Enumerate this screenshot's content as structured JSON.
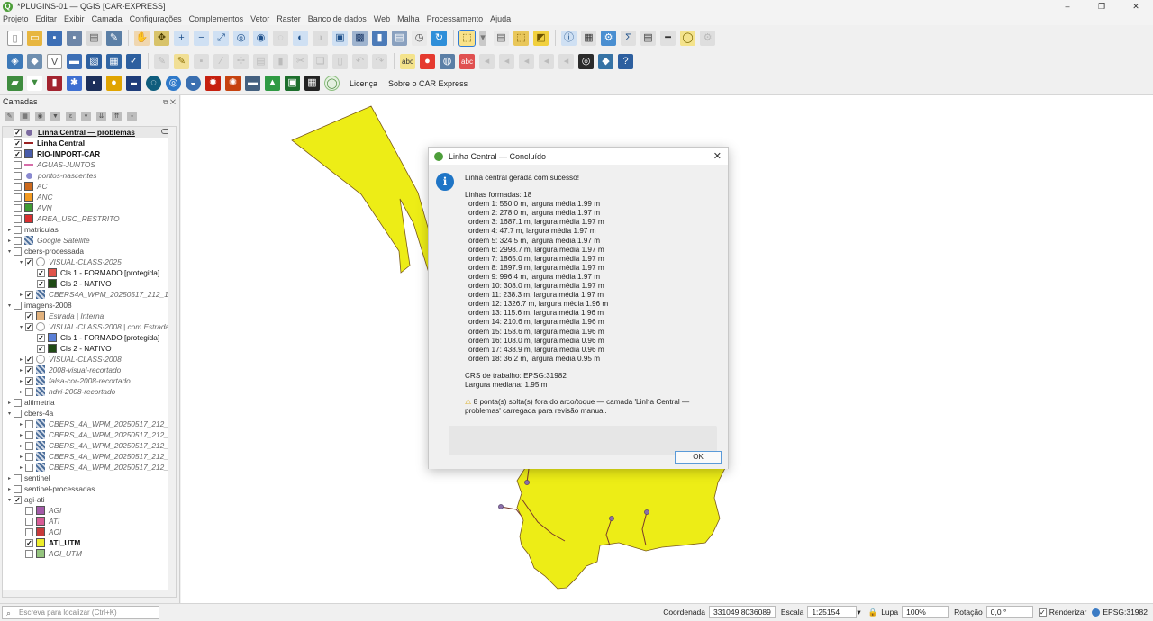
{
  "window": {
    "title": "*PLUGINS-01 — QGIS [CAR-EXPRESS]",
    "controls": [
      "–",
      "❐",
      "✕"
    ]
  },
  "menu": [
    "Projeto",
    "Editar",
    "Exibir",
    "Camada",
    "Configurações",
    "Complementos",
    "Vetor",
    "Raster",
    "Banco de dados",
    "Web",
    "Malha",
    "Processamento",
    "Ajuda"
  ],
  "toolbar3": {
    "licenca": "Licença",
    "sobre": "Sobre o CAR Express"
  },
  "layers_panel": {
    "title": "Camadas",
    "items": [
      {
        "label": "Linha Central — problemas",
        "style": "bu",
        "checked": true,
        "indent": 0,
        "swatch": "#7b6aa0",
        "shape": "dot"
      },
      {
        "label": "Linha Central",
        "style": "b",
        "checked": true,
        "indent": 0,
        "swatch": "#9b2222",
        "shape": "line"
      },
      {
        "label": "RIO-IMPORT-CAR",
        "style": "b",
        "checked": true,
        "indent": 0,
        "swatch": "#4a5dab"
      },
      {
        "label": "AGUAS-JUNTOS",
        "style": "it",
        "checked": false,
        "indent": 0,
        "swatch": "#d66da8",
        "shape": "line"
      },
      {
        "label": "pontos-nascentes",
        "style": "it",
        "checked": false,
        "indent": 0,
        "swatch": "#8a8ad0",
        "shape": "dot"
      },
      {
        "label": "AC",
        "style": "it",
        "checked": false,
        "indent": 0,
        "swatch": "#cc6a1e"
      },
      {
        "label": "ANC",
        "style": "it",
        "checked": false,
        "indent": 0,
        "swatch": "#f29a21"
      },
      {
        "label": "AVN",
        "style": "it",
        "checked": false,
        "indent": 0,
        "swatch": "#3f9c35"
      },
      {
        "label": "AREA_USO_RESTRITO",
        "style": "it",
        "checked": false,
        "indent": 0,
        "swatch": "#d93030"
      },
      {
        "label": "matriculas",
        "style": "gr",
        "checked": false,
        "indent": 0,
        "group": true
      },
      {
        "label": "Google Satellite",
        "style": "it",
        "checked": false,
        "indent": 0,
        "raster": true,
        "exp": true
      },
      {
        "label": "cbers-processada",
        "style": "gr",
        "checked": false,
        "indent": 0,
        "group": true,
        "open": true
      },
      {
        "label": "VISUAL-CLASS-2025",
        "style": "it",
        "checked": true,
        "indent": 1,
        "open": true,
        "vector": true
      },
      {
        "label": "Cls 1 - FORMADO [protegida]",
        "style": "",
        "checked": true,
        "indent": 2,
        "swatch": "#e0534a"
      },
      {
        "label": "Cls 2 - NATIVO",
        "style": "",
        "checked": true,
        "indent": 2,
        "swatch": "#1f4a15"
      },
      {
        "label": "CBERS4A_WPM_20250517_212_135_L",
        "style": "it",
        "checked": true,
        "indent": 1,
        "raster": true,
        "exp": true
      },
      {
        "label": "imagens-2008",
        "style": "gr",
        "checked": false,
        "indent": 0,
        "group": true,
        "open": true
      },
      {
        "label": "Estrada | Interna",
        "style": "it",
        "checked": true,
        "indent": 1,
        "swatch": "#e2b27d"
      },
      {
        "label": "VISUAL-CLASS-2008 | com Estradas",
        "style": "it",
        "checked": true,
        "indent": 1,
        "open": true,
        "vector": true
      },
      {
        "label": "Cls 1 - FORMADO [protegida]",
        "style": "",
        "checked": true,
        "indent": 2,
        "swatch": "#5a7fd6"
      },
      {
        "label": "Cls 2 - NATIVO",
        "style": "",
        "checked": true,
        "indent": 2,
        "swatch": "#1f4a15"
      },
      {
        "label": "VISUAL-CLASS-2008",
        "style": "it",
        "checked": true,
        "indent": 1,
        "vector": true,
        "exp": true
      },
      {
        "label": "2008-visual-recortado",
        "style": "it",
        "checked": true,
        "indent": 1,
        "raster": true,
        "exp": true
      },
      {
        "label": "falsa-cor-2008-recortado",
        "style": "it",
        "checked": true,
        "indent": 1,
        "raster": true,
        "exp": true
      },
      {
        "label": "ndvi-2008-recortado",
        "style": "it",
        "checked": false,
        "indent": 1,
        "raster": true,
        "exp": true
      },
      {
        "label": "altimetria",
        "style": "gr",
        "checked": false,
        "indent": 0,
        "group": true
      },
      {
        "label": "cbers-4a",
        "style": "gr",
        "checked": false,
        "indent": 0,
        "group": true,
        "open": true
      },
      {
        "label": "CBERS_4A_WPM_20250517_212_135_",
        "style": "it",
        "checked": false,
        "indent": 1,
        "raster": true,
        "exp": true
      },
      {
        "label": "CBERS_4A_WPM_20250517_212_135_",
        "style": "it",
        "checked": false,
        "indent": 1,
        "raster": true,
        "exp": true
      },
      {
        "label": "CBERS_4A_WPM_20250517_212_135_",
        "style": "it",
        "checked": false,
        "indent": 1,
        "raster": true,
        "exp": true
      },
      {
        "label": "CBERS_4A_WPM_20250517_212_135_",
        "style": "it",
        "checked": false,
        "indent": 1,
        "raster": true,
        "exp": true
      },
      {
        "label": "CBERS_4A_WPM_20250517_212_135_",
        "style": "it",
        "checked": false,
        "indent": 1,
        "raster": true,
        "exp": true
      },
      {
        "label": "sentinel",
        "style": "gr",
        "checked": false,
        "indent": 0,
        "group": true
      },
      {
        "label": "sentinel-processadas",
        "style": "gr",
        "checked": false,
        "indent": 0,
        "group": true
      },
      {
        "label": "agi-ati",
        "style": "gr",
        "checked": true,
        "indent": 0,
        "group": true,
        "open": true
      },
      {
        "label": "AGI",
        "style": "it",
        "checked": false,
        "indent": 1,
        "swatch": "#a35aa8"
      },
      {
        "label": "ATI",
        "style": "it",
        "checked": false,
        "indent": 1,
        "swatch": "#d85c96"
      },
      {
        "label": "AOI",
        "style": "it",
        "checked": false,
        "indent": 1,
        "swatch": "#c83a3a"
      },
      {
        "label": "ATI_UTM",
        "style": "b",
        "checked": true,
        "indent": 1,
        "swatch": "#eded2a"
      },
      {
        "label": "AOI_UTM",
        "style": "it",
        "checked": false,
        "indent": 1,
        "swatch": "#94c47e"
      }
    ]
  },
  "dialog": {
    "title": "Linha Central — Concluído",
    "success": "Linha central gerada com sucesso!",
    "lines_title": "Linhas formadas: 18",
    "lines": [
      "ordem 1: 550.0 m, largura média 1.99 m",
      "ordem 2: 278.0 m, largura média 1.97 m",
      "ordem 3: 1687.1 m, largura média 1.97 m",
      "ordem 4: 47.7 m, largura média 1.97 m",
      "ordem 5: 324.5 m, largura média 1.97 m",
      "ordem 6: 2998.7 m, largura média 1.97 m",
      "ordem 7: 1865.0 m, largura média 1.97 m",
      "ordem 8: 1897.9 m, largura média 1.97 m",
      "ordem 9: 996.4 m, largura média 1.97 m",
      "ordem 10: 308.0 m, largura média 1.97 m",
      "ordem 11: 238.3 m, largura média 1.97 m",
      "ordem 12: 1326.7 m, largura média 1.96 m",
      "ordem 13: 115.6 m, largura média 1.96 m",
      "ordem 14: 210.6 m, largura média 1.96 m",
      "ordem 15: 158.6 m, largura média 1.96 m",
      "ordem 16: 108.0 m, largura média 0.96 m",
      "ordem 17: 438.9 m, largura média 0.96 m",
      "ordem 18: 36.2 m, largura média 0.95 m"
    ],
    "crs": "CRS de trabalho: EPSG:31982",
    "median": "Largura mediana: 1.95 m",
    "warning": "8 ponta(s) solta(s) fora do arco/toque — camada 'Linha Central — problemas' carregada para revisão manual.",
    "ok": "OK"
  },
  "statusbar": {
    "locator_placeholder": "Escreva para localizar (Ctrl+K)",
    "coord_label": "Coordenada",
    "coord_value": "331049  8036089",
    "scale_label": "Escala",
    "scale_value": "1:25154",
    "lupa_label": "Lupa",
    "lupa_value": "100%",
    "rot_label": "Rotação",
    "rot_value": "0,0 °",
    "render_label": "Renderizar",
    "epsg": "EPSG:31982"
  },
  "colors": {
    "polygon_fill": "#eded16",
    "accent": "#1f75c6"
  }
}
